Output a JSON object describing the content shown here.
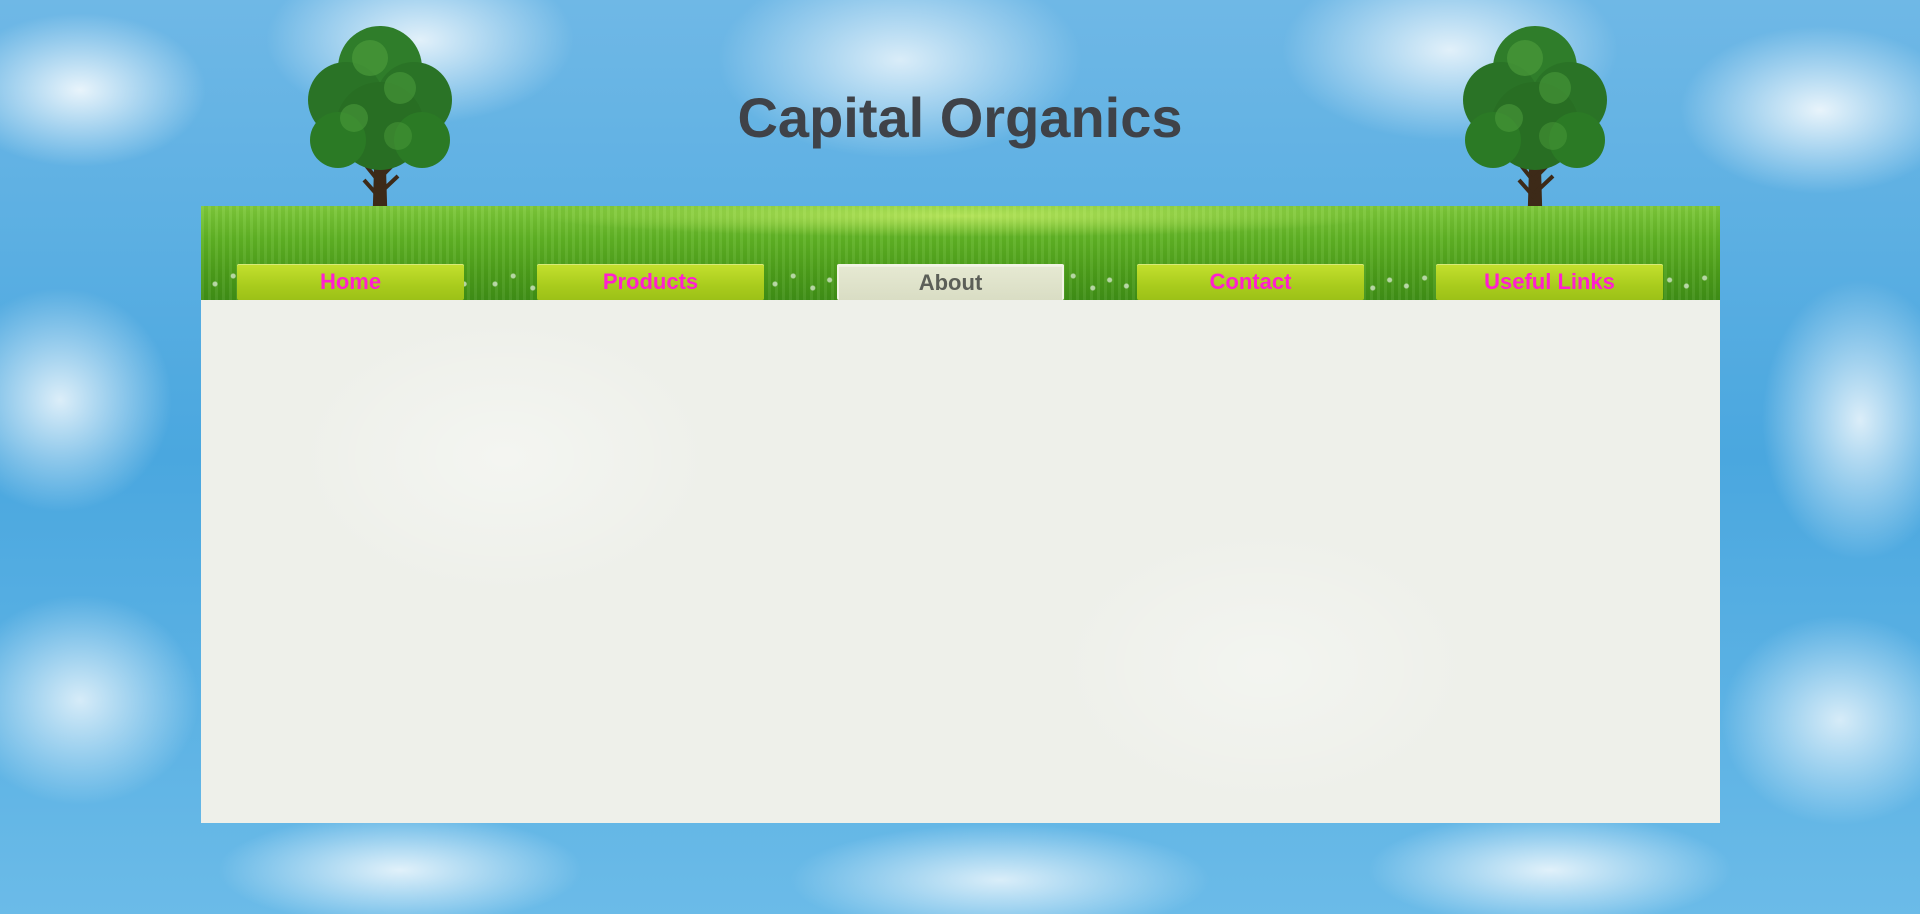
{
  "header": {
    "title": "Capital Organics",
    "icons": [
      "tree-icon",
      "tree-icon"
    ]
  },
  "nav": {
    "items": [
      {
        "label": "Home"
      },
      {
        "label": "Products"
      },
      {
        "label": "About",
        "active": true
      },
      {
        "label": "Contact"
      },
      {
        "label": "Useful Links"
      }
    ]
  },
  "colors": {
    "title": "#3f4248",
    "nav_link": "#ff1fcf",
    "nav_tab": "#a9cc1d",
    "nav_active_text": "#5c5f58",
    "panel": "#eef0ea",
    "sky": "#4aa7df"
  }
}
